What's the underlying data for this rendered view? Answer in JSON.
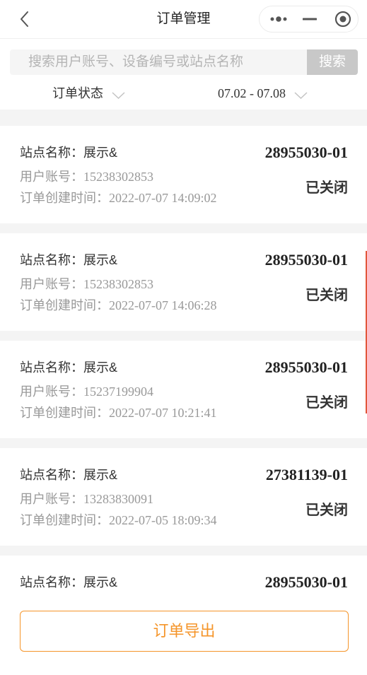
{
  "header": {
    "title": "订单管理",
    "back_icon": "chevron-left-icon",
    "capsule_icons": [
      "more-dots-icon",
      "minimize-icon",
      "target-circle-icon"
    ]
  },
  "search": {
    "placeholder": "搜索用户账号、设备编号或站点名称",
    "value": "",
    "button_label": "搜索"
  },
  "filters": {
    "status_label": "订单状态",
    "date_range": "07.02 - 07.08",
    "dropdown_icon": "chevron-down-icon"
  },
  "order_labels": {
    "station": "站点名称：",
    "account": "用户账号：",
    "created": "订单创建时间："
  },
  "orders": [
    {
      "station": "展示&",
      "account": "15238302853",
      "created": "2022-07-07 14:09:02",
      "order_no": "28955030-01",
      "status": "已关闭"
    },
    {
      "station": "展示&",
      "account": "15238302853",
      "created": "2022-07-07 14:06:28",
      "order_no": "28955030-01",
      "status": "已关闭"
    },
    {
      "station": "展示&",
      "account": "15237199904",
      "created": "2022-07-07 10:21:41",
      "order_no": "28955030-01",
      "status": "已关闭"
    },
    {
      "station": "展示&",
      "account": "13283830091",
      "created": "2022-07-05 18:09:34",
      "order_no": "27381139-01",
      "status": "已关闭"
    },
    {
      "station": "展示&",
      "order_no": "28955030-01"
    }
  ],
  "footer": {
    "export_label": "订单导出"
  },
  "colors": {
    "accent": "#f5952a",
    "text_primary": "#333333",
    "text_secondary": "#999999",
    "page_bg": "#f4f4f4",
    "search_button_bg": "#c8c8c8"
  }
}
